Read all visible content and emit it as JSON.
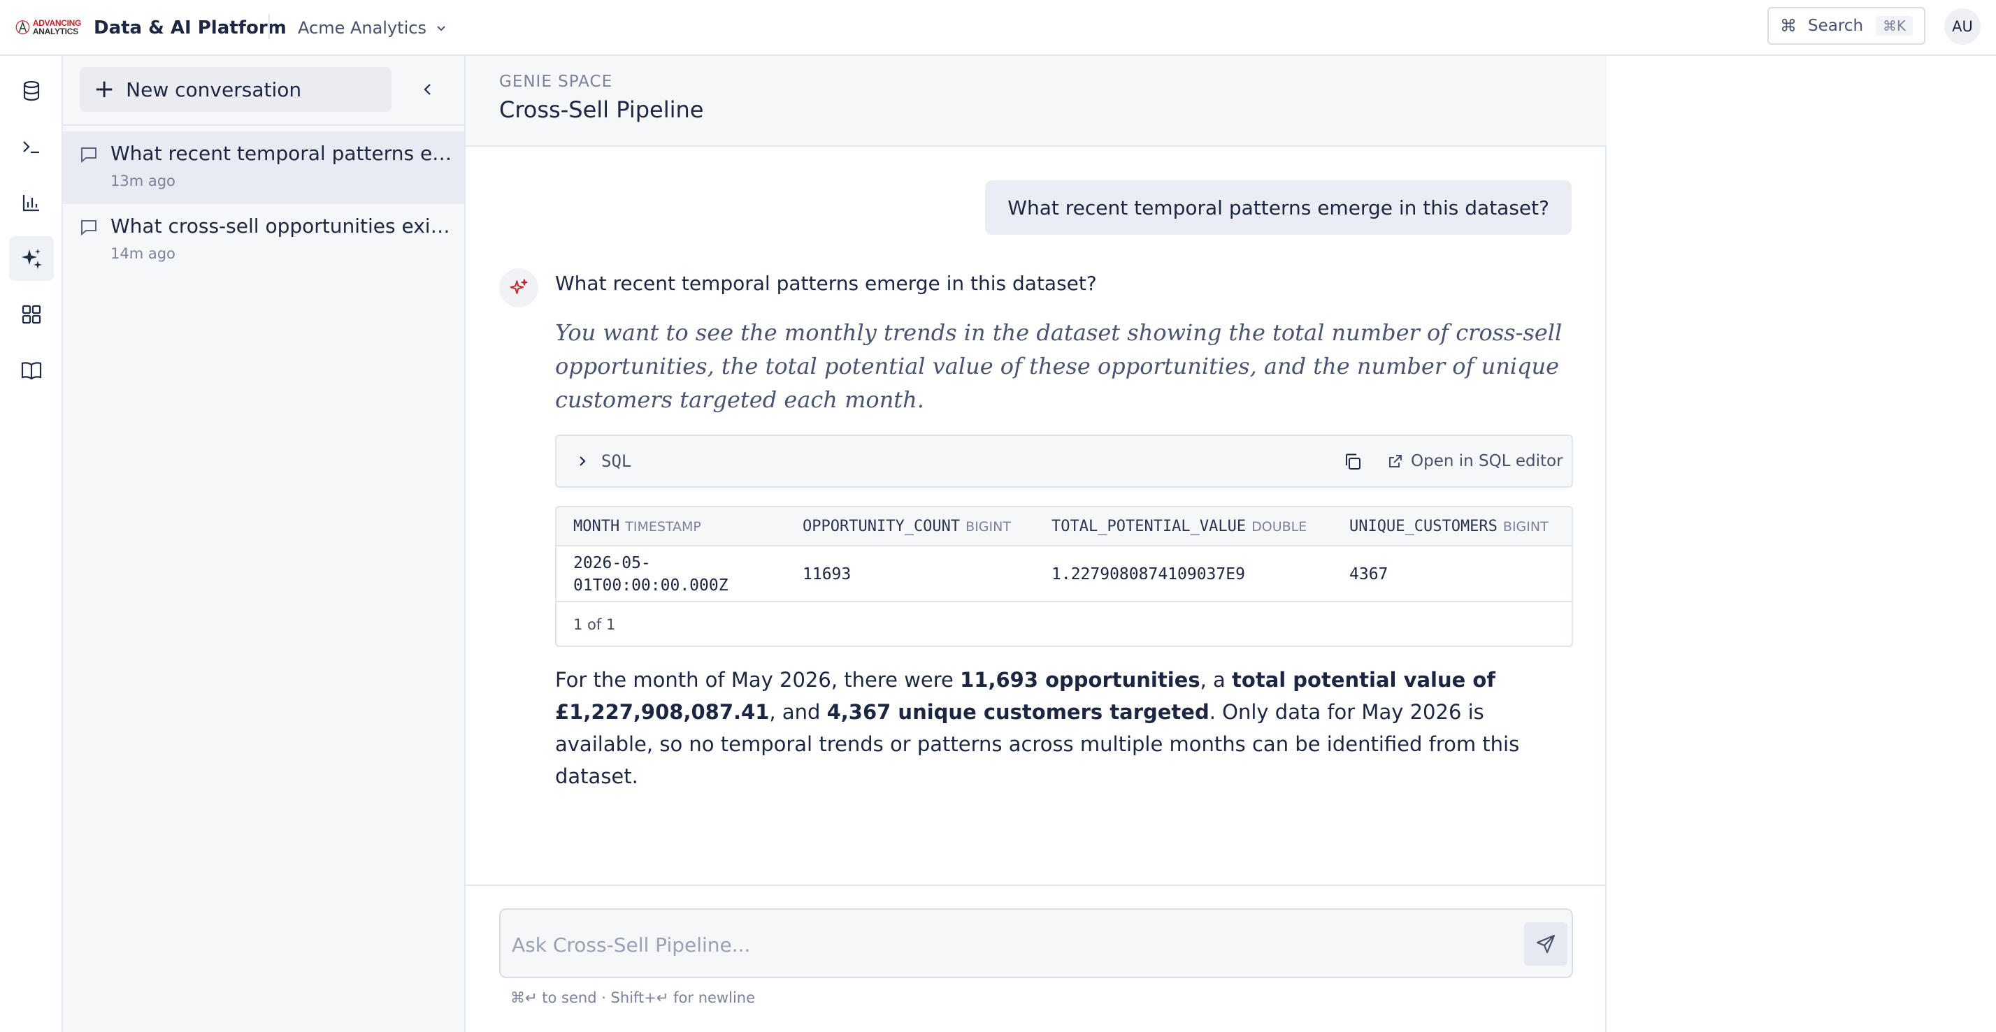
{
  "app": {
    "logo_line1": "ADVANCING",
    "logo_line2": "ANALYTICS",
    "brand": "Data & AI Platform",
    "workspace": "Acme Analytics",
    "search_label": "Search",
    "search_shortcut": "⌘K",
    "user_initials": "AU",
    "accent_color": "#c0262d"
  },
  "rail": {
    "items": [
      {
        "icon": "database-icon",
        "active": false
      },
      {
        "icon": "terminal-icon",
        "active": false
      },
      {
        "icon": "bar-chart-icon",
        "active": false
      },
      {
        "icon": "sparkle-icon",
        "active": true
      },
      {
        "icon": "grid-icon",
        "active": false
      },
      {
        "icon": "book-icon",
        "active": false
      }
    ]
  },
  "sidebar": {
    "new_conversation_label": "New conversation",
    "conversations": [
      {
        "title": "What recent temporal patterns emerge in this dataset?",
        "time": "13m ago",
        "active": true
      },
      {
        "title": "What cross-sell opportunities exist?",
        "time": "14m ago",
        "active": false
      }
    ]
  },
  "space": {
    "eyebrow": "GENIE SPACE",
    "title": "Cross-Sell Pipeline"
  },
  "chat": {
    "user_message": "What recent temporal patterns emerge in this dataset?",
    "answer_question": "What recent temporal patterns emerge in this dataset?",
    "answer_description": "You want to see the monthly trends in the dataset showing the total number of cross-sell opportunities, the total potential value of these opportunities, and the number of unique customers targeted each month.",
    "sql_label": "SQL",
    "open_sql_label": "Open in SQL editor",
    "table": {
      "columns": [
        {
          "name": "MONTH",
          "type": "TIMESTAMP"
        },
        {
          "name": "OPPORTUNITY_COUNT",
          "type": "BIGINT"
        },
        {
          "name": "TOTAL_POTENTIAL_VALUE",
          "type": "DOUBLE"
        },
        {
          "name": "UNIQUE_CUSTOMERS",
          "type": "BIGINT"
        }
      ],
      "rows": [
        {
          "month_line1": "2026-05-",
          "month_line2": "01T00:00:00.000Z",
          "opportunity_count": "11693",
          "total_potential_value": "1.2279080874109037E9",
          "unique_customers": "4367"
        }
      ],
      "pagination": "1 of 1"
    },
    "summary": {
      "p1": "For the month of May 2026, there were ",
      "b1": "11,693 opportunities",
      "p2": ", a ",
      "b2": "total potential value of £1,227,908,087.41",
      "p3": ", and ",
      "b3": "4,367 unique customers targeted",
      "p4": ". Only data for May 2026 is available, so no temporal trends or patterns across multiple months can be identified from this dataset."
    }
  },
  "composer": {
    "placeholder": "Ask Cross-Sell Pipeline...",
    "hint": "⌘↵ to send · Shift+↵ for newline"
  }
}
